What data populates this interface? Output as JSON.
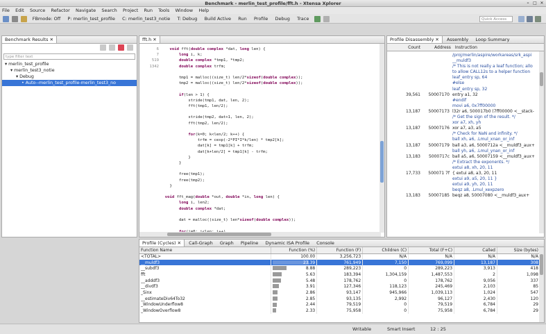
{
  "window": {
    "title": "Benchmark - merlin_test_profile/fft.h - Xtensa Xplorer"
  },
  "menu": [
    "File",
    "Edit",
    "Source",
    "Refactor",
    "Navigate",
    "Search",
    "Project",
    "Run",
    "Tools",
    "Window",
    "Help"
  ],
  "toolbar": {
    "fbmode": "FBmode: Off",
    "project": "P: merlin_test_profile",
    "config": "C: merlin_test3_notie",
    "target": "T: Debug",
    "build_active": "Build Active",
    "run": "Run",
    "profile": "Profile",
    "debug": "Debug",
    "trace": "Trace",
    "quick_access_placeholder": "Quick Access"
  },
  "benchmark": {
    "tab": "Benchmark Results",
    "filter_placeholder": "type filter text",
    "tree": [
      {
        "label": "merlin_test_profile",
        "level": 0
      },
      {
        "label": "merlin_test3_notie",
        "level": 1
      },
      {
        "label": "Debug",
        "level": 2
      },
      {
        "label": "Auto--merlin_test_profile-merlin_test3_no",
        "level": 3,
        "selected": true
      }
    ]
  },
  "editor": {
    "tab": "fft.h",
    "lines": [
      {
        "n": "",
        "t": "    void fft(double complex *dat, long len) {"
      },
      {
        "n": "",
        "t": "        long i, k;"
      },
      {
        "n": "",
        "t": "        double complex *tmp1, *tmp2;"
      },
      {
        "n": "",
        "t": "        double complex trfm;"
      },
      {
        "n": "",
        "t": ""
      },
      {
        "n": "",
        "t": "        tmp1 = malloc((size_t) len/2*sizeof(double complex));"
      },
      {
        "n": "",
        "t": "        tmp2 = malloc((size_t) len/2*sizeof(double complex));"
      },
      {
        "n": "",
        "t": ""
      },
      {
        "n": "",
        "t": "        if(len > 1) {"
      },
      {
        "n": "",
        "t": "            stride(tmp1, dat, len, 2);"
      },
      {
        "n": "",
        "t": "            fft(tmp1, len/2);"
      },
      {
        "n": "",
        "t": ""
      },
      {
        "n": "",
        "t": "            stride(tmp2, dat+1, len, 2);"
      },
      {
        "n": "",
        "t": "            fft(tmp2, len/2);"
      },
      {
        "n": "",
        "t": ""
      },
      {
        "n": "",
        "t": "            for(k=0; k<len/2; k++) {"
      },
      {
        "n": "",
        "t": "                trfm = cexp(-2*PI*I*k/len) * tmp2[k];"
      },
      {
        "n": "",
        "t": "                dat[k] = tmp1[k] + trfm;"
      },
      {
        "n": "",
        "t": "                dat[k+len/2] = tmp1[k] - trfm;"
      },
      {
        "n": "",
        "t": "            }"
      },
      {
        "n": "",
        "t": "        }"
      },
      {
        "n": "",
        "t": ""
      },
      {
        "n": "",
        "t": "        free(tmp1);"
      },
      {
        "n": "",
        "t": "        free(tmp2);"
      },
      {
        "n": "",
        "t": "    }"
      },
      {
        "n": "",
        "t": ""
      },
      {
        "n": "6",
        "t": "  void fft_mag(double *out, double *in, long len) {"
      },
      {
        "n": "",
        "t": "        long i, len2;"
      },
      {
        "n": "",
        "t": "        double complex *dat;"
      },
      {
        "n": "",
        "t": ""
      },
      {
        "n": "7",
        "t": "        dat = malloc((size_t) len*sizeof(double complex));"
      },
      {
        "n": "",
        "t": ""
      },
      {
        "n": "519",
        "t": "        for(i=0; i<len; i++)"
      },
      {
        "n": "1342",
        "t": "            dat[i] = in[i];"
      }
    ]
  },
  "disasm": {
    "tabs": [
      "Profile Disassembly",
      "Assembly",
      "Loop Summary"
    ],
    "headers": [
      "Count",
      "Address",
      "Instruction"
    ],
    "rows": [
      {
        "c": "",
        "a": "",
        "i": "/proj/merlin/aspire/workareas/srk_aspi"
      },
      {
        "c": "",
        "a": "",
        "i": "__muldf3"
      },
      {
        "c": "",
        "a": "",
        "i": "    /* This is not really a leaf function; allo"
      },
      {
        "c": "",
        "a": "",
        "i": "    to allow CALL12s to a helper function"
      },
      {
        "c": "",
        "a": "",
        "i": "    leaf_entry sp, 64"
      },
      {
        "c": "",
        "a": "",
        "i": "#else"
      },
      {
        "c": "",
        "a": "",
        "i": "    leaf_entry sp, 32"
      },
      {
        "c": "39,561",
        "a": "50007170",
        "i": "entry a1, 32"
      },
      {
        "c": "",
        "a": "",
        "i": "#endif"
      },
      {
        "c": "",
        "a": "",
        "i": "    movi    a6, 0x7ff00000"
      },
      {
        "c": "13,187",
        "a": "50007173",
        "i": "l32r a6, 500017b0 (7ff00000 <__stack-"
      },
      {
        "c": "",
        "a": "",
        "i": "    /* Get the sign of the result. */"
      },
      {
        "c": "",
        "a": "",
        "i": "    xor    a7, xh, yh"
      },
      {
        "c": "13,187",
        "a": "50007176",
        "i": "xor a7, a3, a5"
      },
      {
        "c": "",
        "a": "",
        "i": "    /* Check for NaN and infinity. */"
      },
      {
        "c": "",
        "a": "",
        "i": "    ball    xh, a6, .Lmul_xnan_or_inf"
      },
      {
        "c": "13,187",
        "a": "50007179",
        "i": "ball a3, a6, 5000712a <__muldf3_aux+"
      },
      {
        "c": "",
        "a": "",
        "i": "    ball    yh, a6, .Lmul_ynan_or_inf"
      },
      {
        "c": "13,183",
        "a": "5000717c",
        "i": "ball a5, a6, 50007159 <__muldf3_aux+"
      },
      {
        "c": "",
        "a": "",
        "i": "    /* Extract the exponents. */"
      },
      {
        "c": "",
        "a": "",
        "i": "    extui    a8, xh, 20, 11"
      },
      {
        "c": "17,733",
        "a": "500071 7f",
        "i": "{ extui a8, a3, 20, 11"
      },
      {
        "c": "",
        "a": "",
        "i": "  extui a9, a5, 20, 11 }"
      },
      {
        "c": "",
        "a": "",
        "i": "    extui    a9, yh, 20, 11"
      },
      {
        "c": "",
        "a": "",
        "i": "    beqz    a8, .Lmul_xexpzero"
      },
      {
        "c": "13,183",
        "a": "50007185",
        "i": "beqz a8, 50007080 <__muldf3_aux+"
      }
    ]
  },
  "bottom": {
    "tabs": [
      "Profile (Cycles)",
      "Call-Graph",
      "Graph",
      "Pipeline",
      "Dynamic ISA Profile",
      "Console"
    ],
    "headers": [
      "Function Name",
      "Function (%)",
      "Function (F)",
      "Children (C)",
      "Total (F+C)",
      "Called",
      "Size (bytes)"
    ],
    "rows": [
      {
        "name": "<TOTAL>",
        "pct": "100.00",
        "f": "3,256,723",
        "c": "N/A",
        "t": "N/A",
        "called": "N/A",
        "size": "N/A",
        "bar": 0
      },
      {
        "name": "__muldf3",
        "pct": "23.39",
        "f": "761,949",
        "c": "7,150",
        "t": "769,099",
        "called": "13,187",
        "size": "308",
        "bar": 0.2339,
        "selected": true
      },
      {
        "name": "__subdf3",
        "pct": "8.88",
        "f": "289,223",
        "c": "0",
        "t": "289,223",
        "called": "3,913",
        "size": "418",
        "bar": 0.0888
      },
      {
        "name": "fft",
        "pct": "5.63",
        "f": "183,394",
        "c": "1,304,159",
        "t": "1,487,553",
        "called": "2",
        "size": "1,098",
        "bar": 0.0563
      },
      {
        "name": "__adddf3",
        "pct": "5.48",
        "f": "178,762",
        "c": "0",
        "t": "178,762",
        "called": "9,056",
        "size": "337",
        "bar": 0.0548
      },
      {
        "name": "__divdf3",
        "pct": "3.91",
        "f": "127,346",
        "c": "118,123",
        "t": "245,469",
        "called": "2,103",
        "size": "85",
        "bar": 0.0391
      },
      {
        "name": "_Sinx",
        "pct": "2.86",
        "f": "93,147",
        "c": "945,966",
        "t": "1,039,113",
        "called": "1,024",
        "size": "547",
        "bar": 0.0286
      },
      {
        "name": "__estimateDiv64To32",
        "pct": "2.85",
        "f": "93,135",
        "c": "2,992",
        "t": "96,127",
        "called": "2,430",
        "size": "120",
        "bar": 0.0285
      },
      {
        "name": "_WindowUnderflow8",
        "pct": "2.44",
        "f": "79,519",
        "c": "0",
        "t": "79,519",
        "called": "6,784",
        "size": "29",
        "bar": 0.0244
      },
      {
        "name": "_WindowOverflow8",
        "pct": "2.33",
        "f": "75,958",
        "c": "0",
        "t": "75,958",
        "called": "6,784",
        "size": "29",
        "bar": 0.0233
      }
    ]
  },
  "status": {
    "writable": "Writable",
    "insert": "Smart Insert",
    "position": "12 : 25"
  },
  "colors": {
    "selection": "#3875d7",
    "keyword": "#7f0055",
    "bar": "#9a9a9a"
  }
}
